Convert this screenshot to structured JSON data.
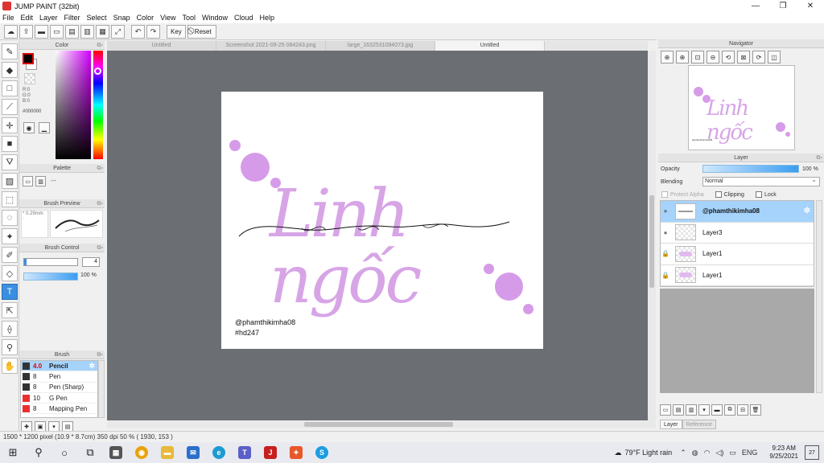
{
  "window": {
    "title": "JUMP PAINT (32bit)",
    "minimize": "—",
    "restore": "❐",
    "close": "✕"
  },
  "menu": [
    "File",
    "Edit",
    "Layer",
    "Filter",
    "Select",
    "Snap",
    "Color",
    "View",
    "Tool",
    "Window",
    "Cloud",
    "Help"
  ],
  "toolbar": {
    "key_label": "Key",
    "reset_label": "Reset"
  },
  "color_panel": {
    "title": "Color",
    "r": "R:0",
    "g": "G:0",
    "b": "B:0",
    "hex": "#000000",
    "fg_color": "#000000"
  },
  "palette_panel": {
    "title": "Palette",
    "dash": "---"
  },
  "brush_preview": {
    "title": "Brush Preview",
    "size_label": "* 0.29mm",
    "dot": "·"
  },
  "brush_control": {
    "title": "Brush Control",
    "size_value": "4",
    "opacity_value": "100 %"
  },
  "brush_panel": {
    "title": "Brush",
    "items": [
      {
        "size": "4.0",
        "name": "Pencil",
        "color": "#333333"
      },
      {
        "size": "8",
        "name": "Pen",
        "color": "#333333"
      },
      {
        "size": "8",
        "name": "Pen (Sharp)",
        "color": "#333333"
      },
      {
        "size": "10",
        "name": "G Pen",
        "color": "#e83030"
      },
      {
        "size": "8",
        "name": "Mapping Pen",
        "color": "#e83030"
      }
    ]
  },
  "tabs": [
    {
      "label": "Untitled"
    },
    {
      "label": "Screenshot 2021-09-25 084243.png"
    },
    {
      "label": "large_1632531094073.jpg"
    },
    {
      "label": "Untitled"
    }
  ],
  "canvas": {
    "lettering": "Linh ngốc",
    "credit_handle": "@phamthikimha08",
    "credit_tag": "#hd247"
  },
  "status": {
    "text": "1500 * 1200 pixel   (10.9 * 8.7cm)   350 dpi   50 %   ( 1930, 153 )"
  },
  "navigator": {
    "title": "Navigator"
  },
  "layer_panel": {
    "title": "Layer",
    "opacity_label": "Opacity",
    "opacity_value": "100 %",
    "blending_label": "Blending",
    "blending_value": "Normal",
    "protect_alpha": "Protect Alpha",
    "clipping": "Clipping",
    "lock": "Lock",
    "layers": [
      {
        "name": "@phamthikimha08"
      },
      {
        "name": "Layer3"
      },
      {
        "name": "Layer1"
      },
      {
        "name": "Layer1"
      }
    ],
    "tab_layer": "Layer",
    "tab_reference": "Reference"
  },
  "taskbar": {
    "weather": "79°F  Light rain",
    "lang": "ENG",
    "time": "9:23 AM",
    "date": "9/25/2021",
    "notifications": "27"
  },
  "colors": {
    "accent": "#3b8fe0",
    "selection": "#a5d3fb",
    "lettering_pink": "#d7a5e6",
    "dot_pink": "#d69be8",
    "workspace": "#6b6e73"
  }
}
